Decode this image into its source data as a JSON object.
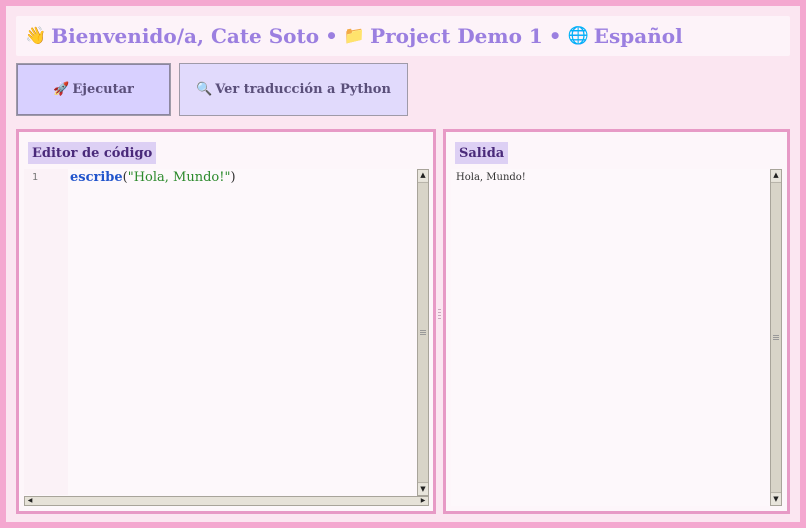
{
  "header": {
    "greeting_emoji": "👋",
    "greeting": "Bienvenido/a, Cate Soto",
    "separator": "•",
    "project_emoji": "📁",
    "project": "Project Demo 1",
    "language_emoji": "🌐",
    "language": "Español"
  },
  "toolbar": {
    "run_emoji": "🚀",
    "run_label": "Ejecutar",
    "translate_emoji": "🔍",
    "translate_label": "Ver traducción a Python"
  },
  "editor": {
    "title": "Editor de código",
    "lines": [
      {
        "number": "1",
        "keyword": "escribe",
        "open": "(",
        "string": "\"Hola, Mundo!\"",
        "close": ")"
      }
    ]
  },
  "output": {
    "title": "Salida",
    "text": "Hola, Mundo!"
  },
  "colors": {
    "frame_pink": "#f4a8d0",
    "header_text": "#9b7fe0",
    "button_bg": "#ddd5ff",
    "label_bg": "#ddd0f4",
    "keyword": "#2255cc",
    "string": "#2b8a2b"
  }
}
